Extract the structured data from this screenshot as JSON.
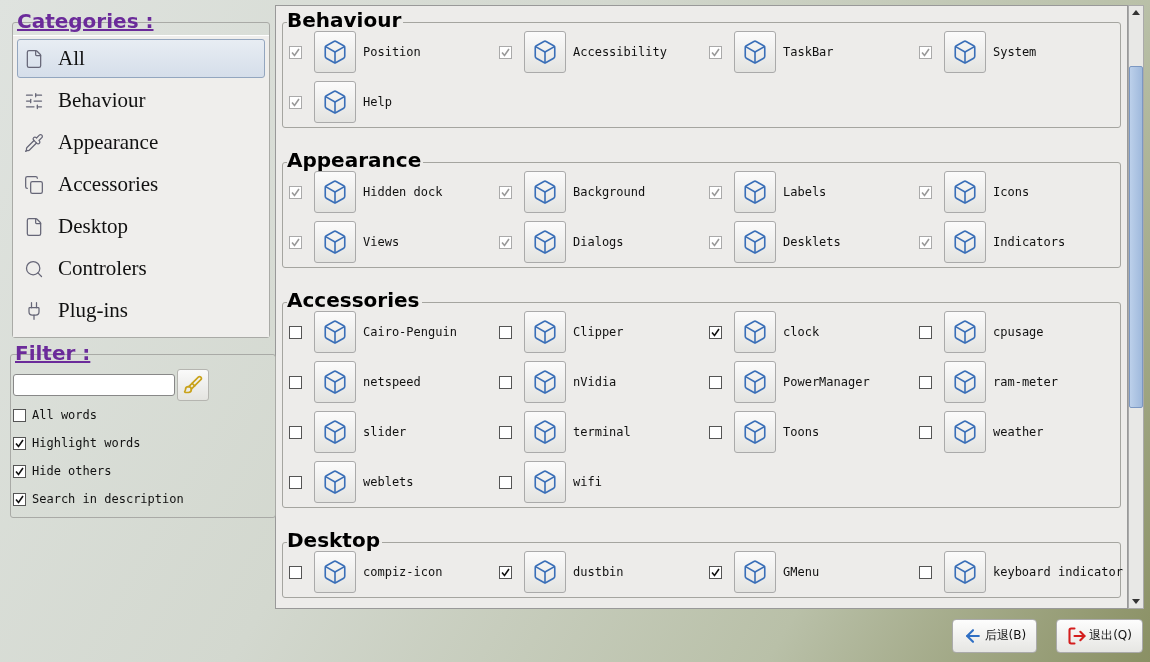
{
  "categories": {
    "title": "Categories :",
    "items": [
      {
        "label": "All",
        "selected": true
      },
      {
        "label": "Behaviour",
        "selected": false
      },
      {
        "label": "Appearance",
        "selected": false
      },
      {
        "label": "Accessories",
        "selected": false
      },
      {
        "label": "Desktop",
        "selected": false
      },
      {
        "label": "Controlers",
        "selected": false
      },
      {
        "label": "Plug-ins",
        "selected": false
      }
    ]
  },
  "filter": {
    "title": "Filter :",
    "options": [
      {
        "label": "All words",
        "checked": false
      },
      {
        "label": "Highlight words",
        "checked": true
      },
      {
        "label": "Hide others",
        "checked": true
      },
      {
        "label": "Search in description",
        "checked": true
      }
    ]
  },
  "sections": [
    {
      "title": "Behaviour",
      "items": [
        {
          "label": "Position",
          "checked": true,
          "disabled": true
        },
        {
          "label": "Accessibility",
          "checked": true,
          "disabled": true
        },
        {
          "label": "TaskBar",
          "checked": true,
          "disabled": true
        },
        {
          "label": "System",
          "checked": true,
          "disabled": true
        },
        {
          "label": "Help",
          "checked": true,
          "disabled": true
        }
      ]
    },
    {
      "title": "Appearance",
      "items": [
        {
          "label": "Hidden dock",
          "checked": true,
          "disabled": true
        },
        {
          "label": "Background",
          "checked": true,
          "disabled": true
        },
        {
          "label": "Labels",
          "checked": true,
          "disabled": true
        },
        {
          "label": "Icons",
          "checked": true,
          "disabled": true
        },
        {
          "label": "Views",
          "checked": true,
          "disabled": true
        },
        {
          "label": "Dialogs",
          "checked": true,
          "disabled": true
        },
        {
          "label": "Desklets",
          "checked": true,
          "disabled": true
        },
        {
          "label": "Indicators",
          "checked": true,
          "disabled": true
        }
      ]
    },
    {
      "title": "Accessories",
      "items": [
        {
          "label": "Cairo-Penguin",
          "checked": false,
          "disabled": false
        },
        {
          "label": "Clipper",
          "checked": false,
          "disabled": false
        },
        {
          "label": "clock",
          "checked": true,
          "disabled": false
        },
        {
          "label": "cpusage",
          "checked": false,
          "disabled": false
        },
        {
          "label": "netspeed",
          "checked": false,
          "disabled": false
        },
        {
          "label": "nVidia",
          "checked": false,
          "disabled": false
        },
        {
          "label": "PowerManager",
          "checked": false,
          "disabled": false
        },
        {
          "label": "ram-meter",
          "checked": false,
          "disabled": false
        },
        {
          "label": "slider",
          "checked": false,
          "disabled": false
        },
        {
          "label": "terminal",
          "checked": false,
          "disabled": false
        },
        {
          "label": "Toons",
          "checked": false,
          "disabled": false
        },
        {
          "label": "weather",
          "checked": false,
          "disabled": false
        },
        {
          "label": "weblets",
          "checked": false,
          "disabled": false
        },
        {
          "label": "wifi",
          "checked": false,
          "disabled": false
        }
      ]
    },
    {
      "title": "Desktop",
      "items": [
        {
          "label": "compiz-icon",
          "checked": false,
          "disabled": false
        },
        {
          "label": "dustbin",
          "checked": true,
          "disabled": false
        },
        {
          "label": "GMenu",
          "checked": true,
          "disabled": false
        },
        {
          "label": "keyboard indicator",
          "checked": false,
          "disabled": false
        }
      ]
    }
  ],
  "buttons": [
    {
      "label": "后退(B)",
      "kind": "back"
    },
    {
      "label": "退出(Q)",
      "kind": "quit"
    }
  ]
}
